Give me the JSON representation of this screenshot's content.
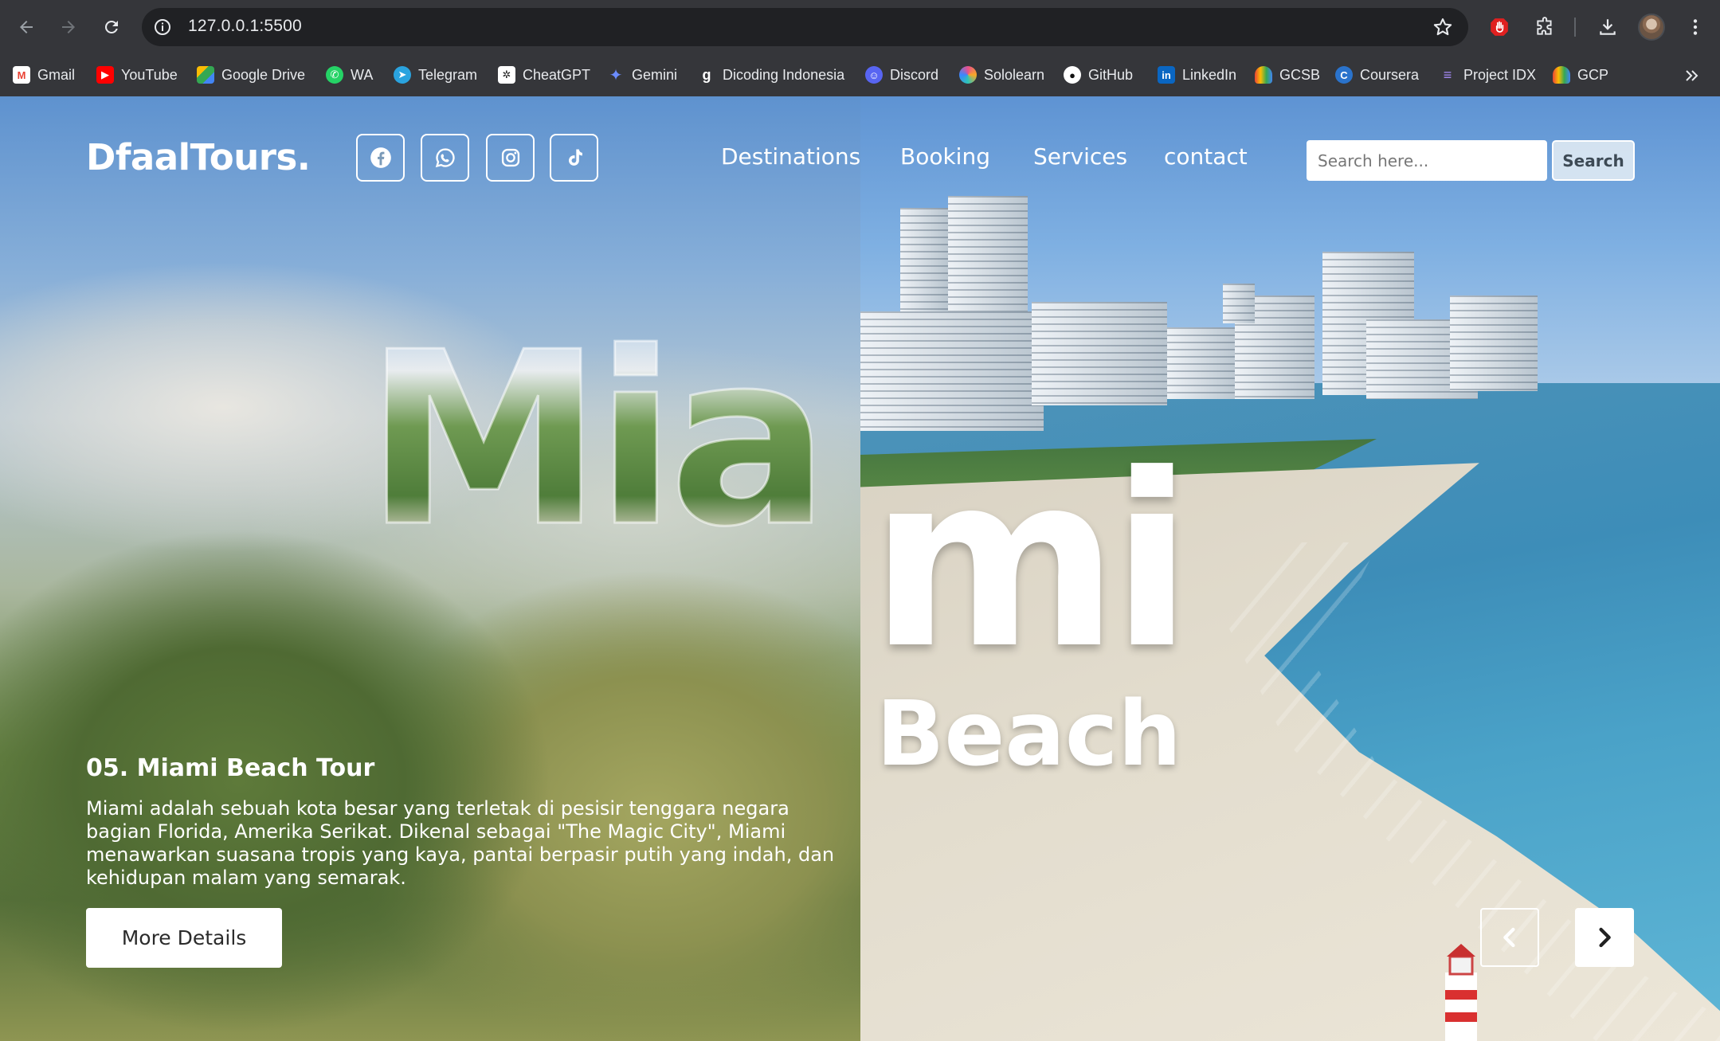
{
  "browser": {
    "url": "127.0.0.1:5500",
    "bookmarks": [
      {
        "label": "Gmail",
        "icon": "gmail-icon",
        "color": "#ea4335"
      },
      {
        "label": "YouTube",
        "icon": "youtube-icon",
        "color": "#ff0000"
      },
      {
        "label": "Google Drive",
        "icon": "google-drive-icon",
        "color": "#34a853"
      },
      {
        "label": "WA",
        "icon": "whatsapp-icon",
        "color": "#25d366"
      },
      {
        "label": "Telegram",
        "icon": "telegram-icon",
        "color": "#2aa3df"
      },
      {
        "label": "CheatGPT",
        "icon": "chatgpt-icon",
        "color": "#ffffff"
      },
      {
        "label": "Gemini",
        "icon": "gemini-icon",
        "color": "#6b8cff"
      },
      {
        "label": "Dicoding Indonesia",
        "icon": "dicoding-icon",
        "color": "#ffffff"
      },
      {
        "label": "Discord",
        "icon": "discord-icon",
        "color": "#5865f2"
      },
      {
        "label": "Sololearn",
        "icon": "sololearn-icon",
        "color": "#e94f8c"
      },
      {
        "label": "GitHub",
        "icon": "github-icon",
        "color": "#ffffff"
      },
      {
        "label": "LinkedIn",
        "icon": "linkedin-icon",
        "color": "#0a66c2"
      },
      {
        "label": "GCSB",
        "icon": "google-cloud-icon",
        "color": "#fbbc04"
      },
      {
        "label": "Coursera",
        "icon": "coursera-icon",
        "color": "#2a73cc"
      },
      {
        "label": "Project IDX",
        "icon": "project-idx-icon",
        "color": "#a78bfa"
      },
      {
        "label": "GCP",
        "icon": "google-cloud-icon",
        "color": "#4285f4"
      }
    ]
  },
  "site": {
    "logo": "DfaalTours.",
    "social": [
      "facebook-icon",
      "whatsapp-icon",
      "instagram-icon",
      "tiktok-icon"
    ],
    "nav": {
      "destinations": "Destinations",
      "booking": "Booking",
      "services": "Services",
      "contact": "contact"
    },
    "search": {
      "placeholder": "Search here...",
      "button": "Search"
    }
  },
  "hero": {
    "word_part1": "Mia",
    "word_part2": "mi",
    "word_line2": "Beach",
    "tour_title": "05. Miami Beach Tour",
    "description": "Miami adalah sebuah kota besar yang terletak di pesisir tenggara negara bagian Florida, Amerika Serikat. Dikenal sebagai \"The Magic City\", Miami menawarkan suasana tropis yang kaya, pantai berpasir putih yang indah, dan kehidupan malam yang semarak.",
    "more_button": "More Details"
  },
  "colors": {
    "chrome_bg": "#35363a",
    "omnibox_bg": "#202124",
    "accent_text": "#ffffff"
  }
}
